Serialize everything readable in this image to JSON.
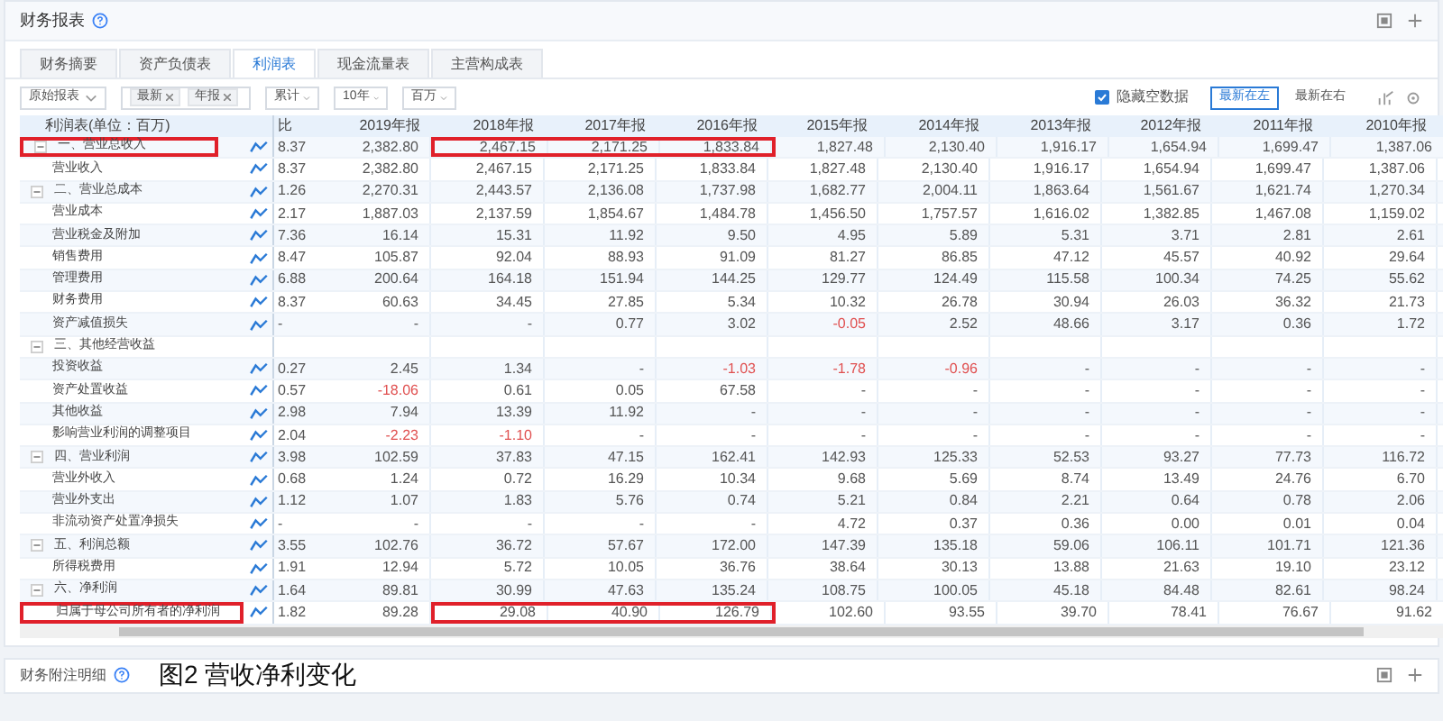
{
  "panel": {
    "title": "财务报表"
  },
  "tabs": [
    {
      "label": "财务摘要",
      "selected": false
    },
    {
      "label": "资产负债表",
      "selected": false
    },
    {
      "label": "利润表",
      "selected": true
    },
    {
      "label": "现金流量表",
      "selected": false
    },
    {
      "label": "主营构成表",
      "selected": false
    }
  ],
  "toolbar": {
    "report_type": "原始报表",
    "filters": [
      "最新",
      "年报"
    ],
    "period": "累计",
    "range": "10年",
    "unit": "百万",
    "hide_empty": {
      "label": "隐藏空数据",
      "checked": true
    },
    "order_buttons": [
      {
        "label": "最新在左",
        "selected": true
      },
      {
        "label": "最新在右",
        "selected": false
      }
    ]
  },
  "table": {
    "name_header": "利润表(单位：百万)",
    "columns": [
      "比",
      "2019年报",
      "2018年报",
      "2017年报",
      "2016年报",
      "2015年报",
      "2014年报",
      "2013年报",
      "2012年报",
      "2011年报",
      "2010年报"
    ],
    "rows": [
      {
        "name": "一、营业总收入",
        "expanded": true,
        "highlight": true,
        "trend": true,
        "values": [
          "8.37",
          "2,382.80",
          "2,467.15",
          "2,171.25",
          "1,833.84",
          "1,827.48",
          "2,130.40",
          "1,916.17",
          "1,654.94",
          "1,699.47",
          "1,387.06"
        ],
        "children": [
          {
            "name": "营业收入",
            "highlight": false,
            "trend": true,
            "values": [
              "8.37",
              "2,382.80",
              "2,467.15",
              "2,171.25",
              "1,833.84",
              "1,827.48",
              "2,130.40",
              "1,916.17",
              "1,654.94",
              "1,699.47",
              "1,387.06"
            ]
          }
        ]
      },
      {
        "name": "二、营业总成本",
        "expanded": true,
        "highlight": false,
        "trend": true,
        "values": [
          "1.26",
          "2,270.31",
          "2,443.57",
          "2,136.08",
          "1,737.98",
          "1,682.77",
          "2,004.11",
          "1,863.64",
          "1,561.67",
          "1,621.74",
          "1,270.34"
        ],
        "children": [
          {
            "name": "营业成本",
            "highlight": false,
            "trend": true,
            "values": [
              "2.17",
              "1,887.03",
              "2,137.59",
              "1,854.67",
              "1,484.78",
              "1,456.50",
              "1,757.57",
              "1,616.02",
              "1,382.85",
              "1,467.08",
              "1,159.02"
            ]
          },
          {
            "name": "营业税金及附加",
            "highlight": false,
            "trend": true,
            "values": [
              "7.36",
              "16.14",
              "15.31",
              "11.92",
              "9.50",
              "4.95",
              "5.89",
              "5.31",
              "3.71",
              "2.81",
              "2.61"
            ]
          },
          {
            "name": "销售费用",
            "highlight": false,
            "trend": true,
            "values": [
              "8.47",
              "105.87",
              "92.04",
              "88.93",
              "91.09",
              "81.27",
              "86.85",
              "47.12",
              "45.57",
              "40.92",
              "29.64"
            ]
          },
          {
            "name": "管理费用",
            "highlight": false,
            "trend": true,
            "values": [
              "6.88",
              "200.64",
              "164.18",
              "151.94",
              "144.25",
              "129.77",
              "124.49",
              "115.58",
              "100.34",
              "74.25",
              "55.62"
            ]
          },
          {
            "name": "财务费用",
            "highlight": false,
            "trend": true,
            "values": [
              "8.37",
              "60.63",
              "34.45",
              "27.85",
              "5.34",
              "10.32",
              "26.78",
              "30.94",
              "26.03",
              "36.32",
              "21.73"
            ]
          },
          {
            "name": "资产减值损失",
            "highlight": false,
            "trend": true,
            "values": [
              "-",
              "-",
              "-",
              "0.77",
              "3.02",
              {
                "text": "-0.05",
                "negative": true
              },
              "2.52",
              "48.66",
              "3.17",
              "0.36",
              "1.72"
            ]
          }
        ]
      },
      {
        "name": "三、其他经营收益",
        "expanded": true,
        "highlight": false,
        "trend": false,
        "children": [
          {
            "name": "投资收益",
            "highlight": false,
            "trend": true,
            "values": [
              "0.27",
              "2.45",
              "1.34",
              "-",
              {
                "text": "-1.03",
                "negative": true
              },
              {
                "text": "-1.78",
                "negative": true
              },
              {
                "text": "-0.96",
                "negative": true
              },
              "-",
              "-",
              "-",
              "-"
            ]
          },
          {
            "name": "资产处置收益",
            "highlight": false,
            "trend": true,
            "values": [
              "0.57",
              {
                "text": "-18.06",
                "negative": true
              },
              "0.61",
              "0.05",
              "67.58",
              "-",
              "-",
              "-",
              "-",
              "-",
              "-"
            ]
          },
          {
            "name": "其他收益",
            "highlight": false,
            "trend": true,
            "values": [
              "2.98",
              "7.94",
              "13.39",
              "11.92",
              "-",
              "-",
              "-",
              "-",
              "-",
              "-",
              "-"
            ]
          },
          {
            "name": "影响营业利润的调整项目",
            "highlight": false,
            "trend": true,
            "values": [
              "2.04",
              {
                "text": "-2.23",
                "negative": true
              },
              {
                "text": "-1.10",
                "negative": true
              },
              "-",
              "-",
              "-",
              "-",
              "-",
              "-",
              "-",
              "-"
            ]
          }
        ]
      },
      {
        "name": "四、营业利润",
        "expanded": true,
        "highlight": false,
        "trend": true,
        "values": [
          "3.98",
          "102.59",
          "37.83",
          "47.15",
          "162.41",
          "142.93",
          "125.33",
          "52.53",
          "93.27",
          "77.73",
          "116.72"
        ],
        "children": [
          {
            "name": "营业外收入",
            "highlight": false,
            "trend": true,
            "values": [
              "0.68",
              "1.24",
              "0.72",
              "16.29",
              "10.34",
              "9.68",
              "5.69",
              "8.74",
              "13.49",
              "24.76",
              "6.70"
            ]
          },
          {
            "name": "营业外支出",
            "highlight": false,
            "trend": true,
            "values": [
              "1.12",
              "1.07",
              "1.83",
              "5.76",
              "0.74",
              "5.21",
              "0.84",
              "2.21",
              "0.64",
              "0.78",
              "2.06"
            ]
          },
          {
            "name": "非流动资产处置净损失",
            "highlight": false,
            "trend": true,
            "values": [
              "-",
              "-",
              "-",
              "-",
              "-",
              "4.72",
              "0.37",
              "0.36",
              "0.00",
              "0.01",
              "0.04"
            ]
          }
        ]
      },
      {
        "name": "五、利润总额",
        "expanded": true,
        "highlight": false,
        "trend": true,
        "values": [
          "3.55",
          "102.76",
          "36.72",
          "57.67",
          "172.00",
          "147.39",
          "135.18",
          "59.06",
          "106.11",
          "101.71",
          "121.36"
        ],
        "children": [
          {
            "name": "所得税费用",
            "highlight": false,
            "trend": true,
            "values": [
              "1.91",
              "12.94",
              "5.72",
              "10.05",
              "36.76",
              "38.64",
              "30.13",
              "13.88",
              "21.63",
              "19.10",
              "23.12"
            ]
          }
        ]
      },
      {
        "name": "六、净利润",
        "expanded": true,
        "highlight": false,
        "trend": true,
        "values": [
          "1.64",
          "89.81",
          "30.99",
          "47.63",
          "135.24",
          "108.75",
          "100.05",
          "45.18",
          "84.48",
          "82.61",
          "98.24"
        ],
        "children": [
          {
            "name": "归属于母公司所有者的净利润",
            "highlight": true,
            "trend": true,
            "values": [
              "1.82",
              "89.28",
              "29.08",
              "40.90",
              "126.79",
              "102.60",
              "93.55",
              "39.70",
              "78.41",
              "76.67",
              "91.62"
            ]
          }
        ]
      }
    ]
  },
  "footer": {
    "title": "财务附注明细",
    "caption": "图2 营收净利变化"
  }
}
